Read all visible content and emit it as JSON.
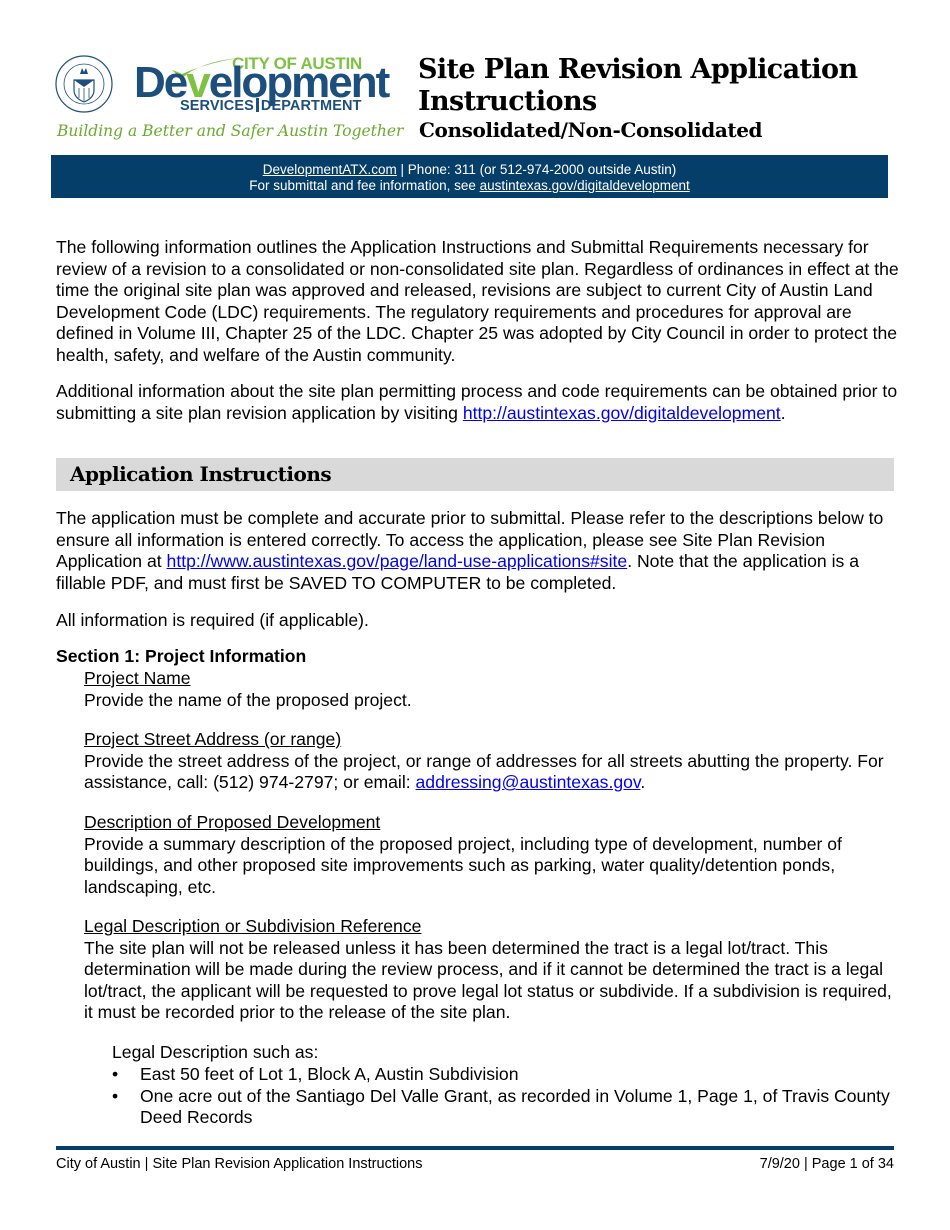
{
  "header": {
    "logo": {
      "seal_label": "CITY OF AUSTIN",
      "city_of_austin": "CITY OF AUSTIN",
      "development_part1": "De",
      "development_v": "v",
      "development_part2": "elopment",
      "services": "SERVICES",
      "department": "DEPARTMENT",
      "tagline": "Building a Better and Safer Austin Together"
    },
    "title_line1": "Site Plan Revision Application",
    "title_line2": "Instructions",
    "subtitle": "Consolidated/Non-Consolidated"
  },
  "band": {
    "website_link": "DevelopmentATX.com",
    "phone_text": " | Phone: 311 (or 512-974-2000 outside Austin)",
    "line2_prefix": "For submittal and fee information, see ",
    "line2_link": "austintexas.gov/digitaldevelopment"
  },
  "intro": {
    "paragraph1": "The following information outlines the Application Instructions and Submittal Requirements necessary for review of a revision to a consolidated or non-consolidated site plan. Regardless of ordinances in effect at the time the original site plan was approved and released, revisions are subject to current City of Austin Land Development Code (LDC) requirements. The regulatory requirements and procedures for approval are defined in Volume III, Chapter 25 of the LDC. Chapter 25 was adopted by City Council in order to protect the health, safety, and welfare of the Austin community.",
    "paragraph2_text": "Additional information about the site plan permitting process and code requirements can be obtained prior to submitting a site plan revision application by visiting ",
    "paragraph2_link": "http://austintexas.gov/digitaldevelopment",
    "paragraph2_end": "."
  },
  "application_instructions": {
    "heading": "Application Instructions",
    "paragraph1_text": "The application must be complete and accurate prior to submittal. Please refer to the descriptions below to ensure all information is entered correctly. To access the application, please see Site Plan Revision Application at ",
    "paragraph1_link": "http://www.austintexas.gov/page/land-use-applications#site",
    "paragraph1_end": ". Note that the application is a fillable PDF, and must first be SAVED TO COMPUTER to be completed.",
    "paragraph2": "All information is required (if applicable)."
  },
  "section1": {
    "heading": "Section 1: Project Information",
    "items": [
      {
        "label": "Project Name",
        "text": "Provide the name of the proposed project."
      },
      {
        "label": "Project Street Address (or range)",
        "text": "Provide the street address of the project, or range of addresses for all streets abutting the property. For assistance, call: (512) 974-2797; or email: ",
        "link": "addressing@austintexas.gov",
        "text_end": "."
      },
      {
        "label": "Description of Proposed Development",
        "text": "Provide a summary description of the proposed project, including type of development, number of buildings, and other proposed site improvements such as parking, water quality/detention ponds, landscaping, etc."
      },
      {
        "label": "Legal Description or Subdivision Reference",
        "text": "The site plan will not be released unless it has been determined the tract is a legal lot/tract. This determination will be made during the review process, and if it cannot be determined the tract is a legal lot/tract, the applicant will be requested to prove legal lot status or subdivide. If a subdivision is required, it must be recorded prior to the release of the site plan."
      }
    ],
    "legal_examples_intro": "Legal Description such as:",
    "legal_examples": [
      "East 50 feet of Lot 1, Block A, Austin Subdivision",
      "One acre out of the Santiago Del Valle Grant, as recorded in Volume 1, Page 1, of Travis County Deed Records"
    ]
  },
  "footer": {
    "left": "City of Austin | Site Plan Revision Application Instructions",
    "right": "7/9/20 | Page 1 of 34"
  },
  "colors": {
    "brand_blue": "#063e6a",
    "logo_blue": "#1d4f7c",
    "logo_green": "#7dc242",
    "link_blue": "#0000ee",
    "section_bar_gray": "#d9d9d9"
  }
}
